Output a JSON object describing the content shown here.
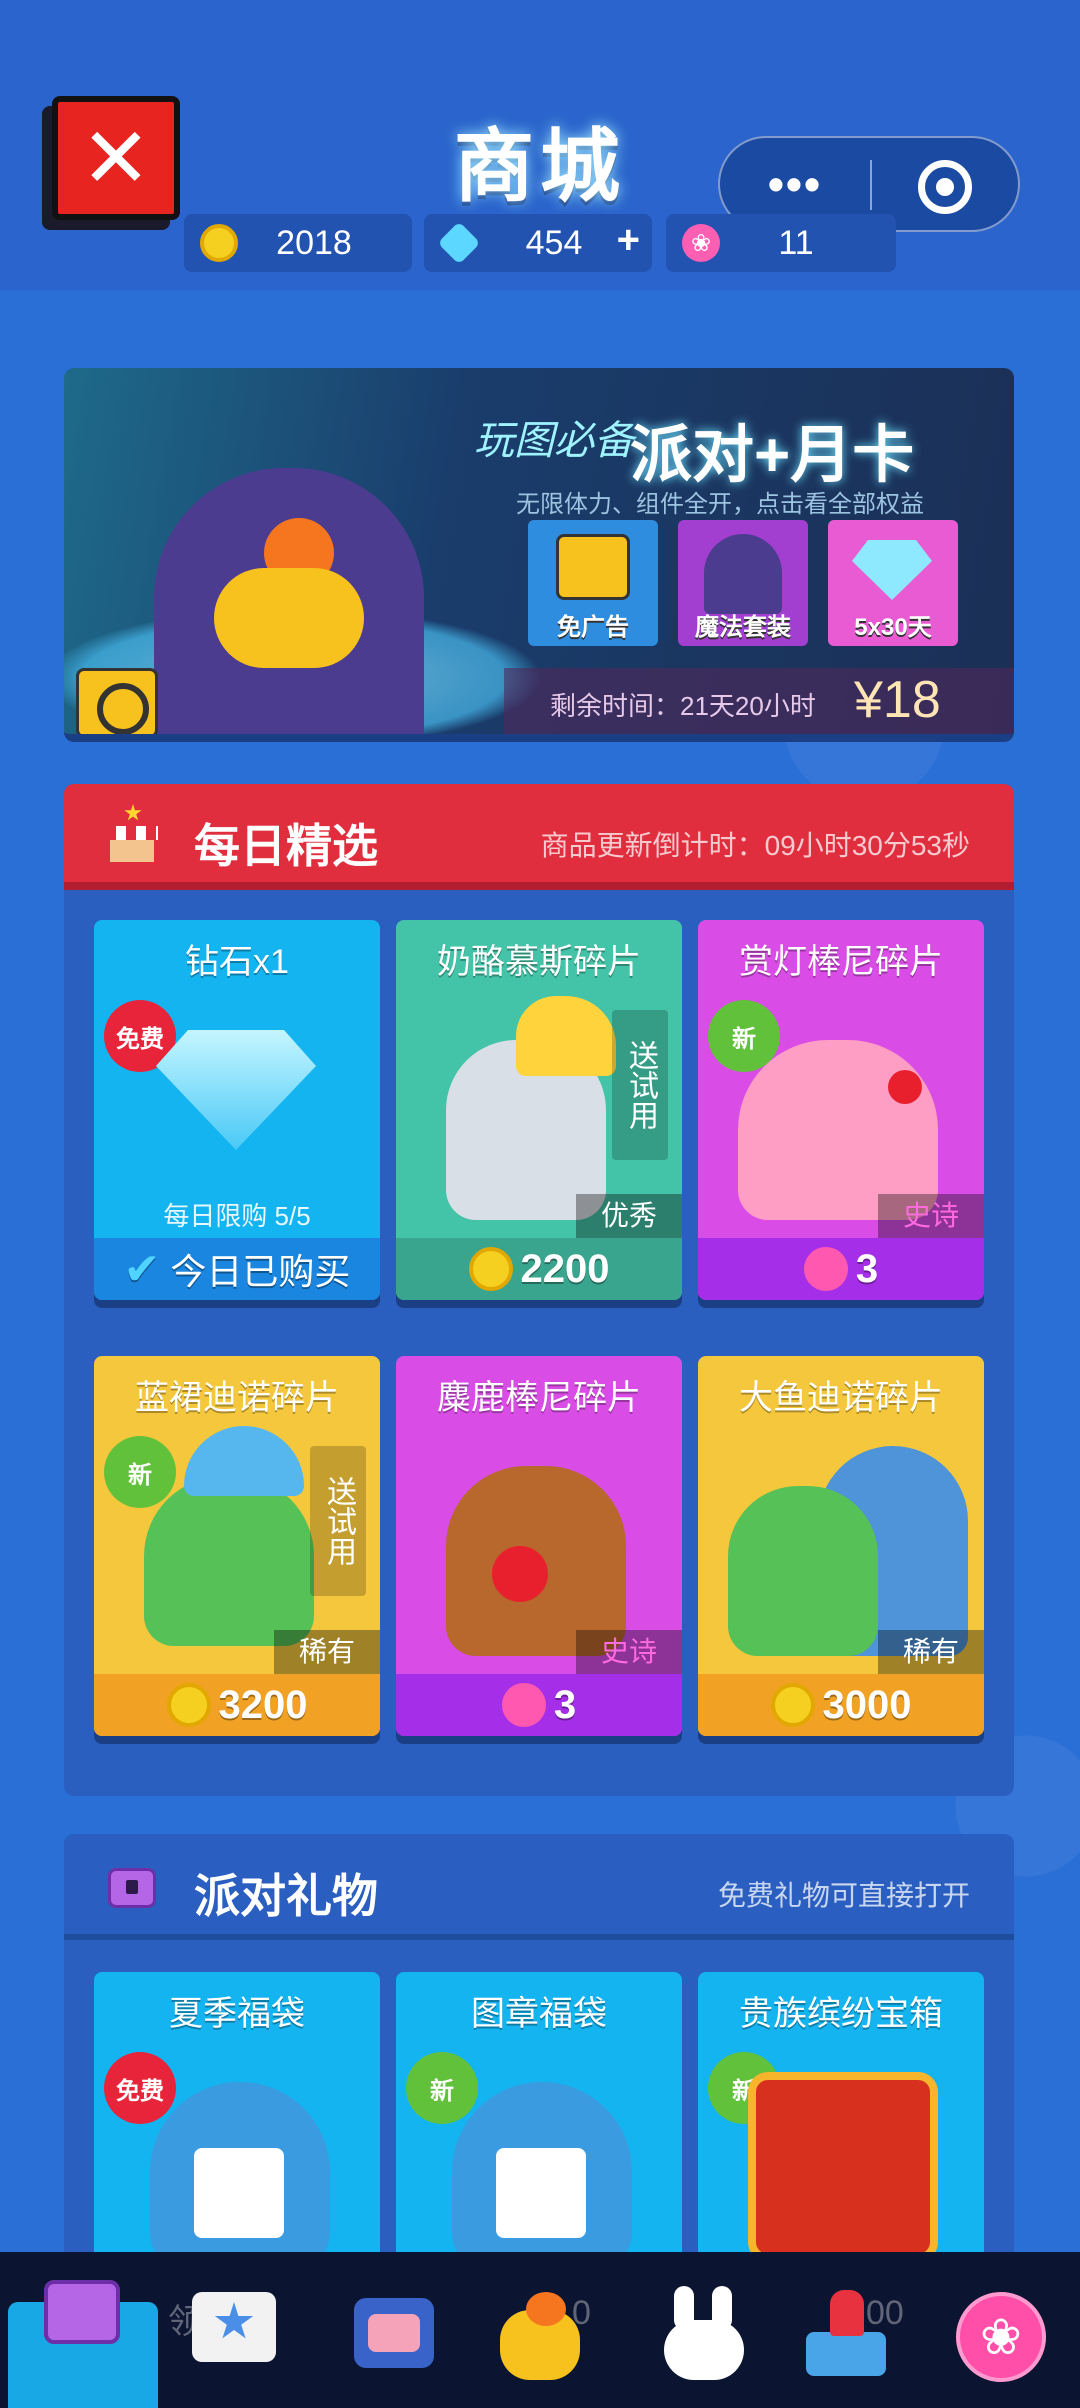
{
  "header": {
    "title": "商城"
  },
  "currencies": [
    {
      "icon": "coin-icon",
      "value": "2018"
    },
    {
      "icon": "diamond-icon",
      "value": "454",
      "add": "+"
    },
    {
      "icon": "lotus-icon",
      "value": "11"
    }
  ],
  "capsule": {
    "more": "•••"
  },
  "banner": {
    "slogan": "玩图必备",
    "title": "派对+月卡",
    "subtitle": "无限体力、组件全开，点击看全部权益",
    "perks": [
      "免广告",
      "魔法套装",
      "5x30天"
    ],
    "time_left": "剩余时间：21天20小时",
    "price": "¥18"
  },
  "daily": {
    "title": "每日精选",
    "countdown": "商品更新倒计时：09小时30分53秒",
    "items": [
      {
        "name": "钻石x1",
        "badge": "免费",
        "limit": "每日限购 5/5",
        "footer": "今日已购买",
        "footer_icon": "check-icon"
      },
      {
        "name": "奶酪慕斯碎片",
        "trial": "送试用",
        "rarity": "优秀",
        "price": "2200",
        "currency": "coin"
      },
      {
        "name": "赏灯棒尼碎片",
        "badge": "新",
        "rarity": "史诗",
        "price": "3",
        "currency": "lotus"
      },
      {
        "name": "蓝裙迪诺碎片",
        "badge": "新",
        "trial": "送试用",
        "rarity": "稀有",
        "price": "3200",
        "currency": "coin"
      },
      {
        "name": "麋鹿棒尼碎片",
        "rarity": "史诗",
        "price": "3",
        "currency": "lotus"
      },
      {
        "name": "大鱼迪诺碎片",
        "rarity": "稀有",
        "price": "3000",
        "currency": "coin"
      }
    ]
  },
  "party": {
    "title": "派对礼物",
    "note": "免费礼物可直接打开",
    "items": [
      {
        "name": "夏季福袋",
        "badge": "免费"
      },
      {
        "name": "图章福袋",
        "badge": "新"
      },
      {
        "name": "贵族缤纷宝箱",
        "badge": "新"
      }
    ]
  },
  "bottom_ghost": {
    "left": "领取",
    "mid": "0",
    "right": "00"
  },
  "colors": {
    "daily_header": "#e02e3f",
    "panel": "#2a5fc0",
    "bg": "#2a6fd6"
  }
}
